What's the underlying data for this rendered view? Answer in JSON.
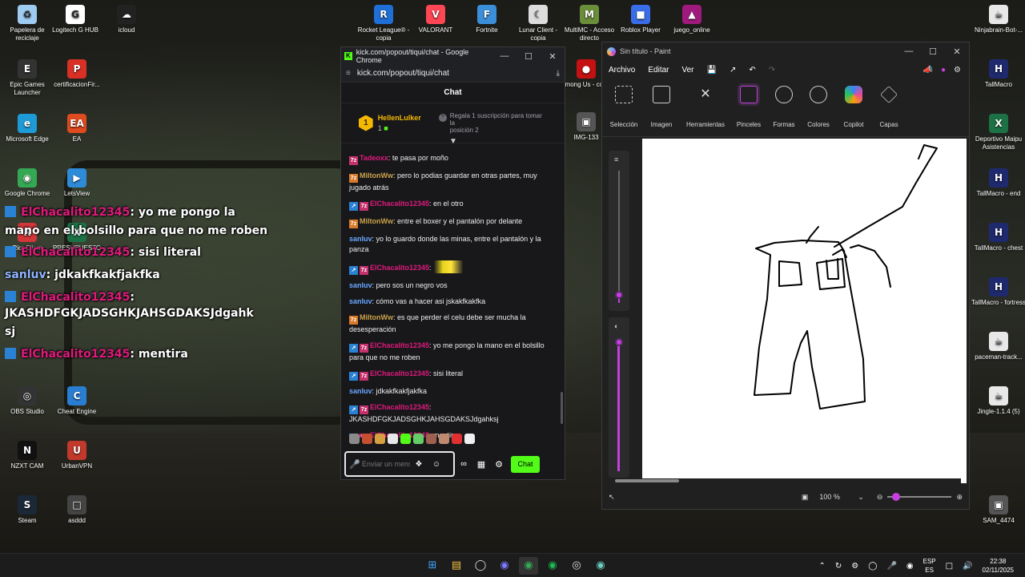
{
  "desktop": {
    "icons_left": [
      {
        "label": "Papelera de reciclaje",
        "icon": "recycle-bin-icon"
      },
      {
        "label": "Logitech G HUB",
        "icon": "logitech-icon"
      },
      {
        "label": "icloud",
        "icon": "icloud-icon"
      },
      {
        "label": "Epic Games Launcher",
        "icon": "epic-icon"
      },
      {
        "label": "certificacionFir...",
        "icon": "pdf-icon"
      },
      {
        "label": "Microsoft Edge",
        "icon": "edge-icon"
      },
      {
        "label": "EA",
        "icon": "ea-icon"
      },
      {
        "label": "Google Chrome",
        "icon": "chrome-icon"
      },
      {
        "label": "LetsView",
        "icon": "letsview-icon"
      },
      {
        "label": "Riot Client",
        "icon": "riot-icon"
      },
      {
        "label": "PRESUPUESTO",
        "icon": "excel-icon"
      },
      {
        "label": "OBS Studio",
        "icon": "obs-icon"
      },
      {
        "label": "Cheat Engine",
        "icon": "cheat-engine-icon"
      },
      {
        "label": "NZXT CAM",
        "icon": "nzxt-icon"
      },
      {
        "label": "UrbanVPN",
        "icon": "urbanvpn-icon"
      },
      {
        "label": "Steam",
        "icon": "steam-icon"
      },
      {
        "label": "asddd",
        "icon": "file-icon"
      }
    ],
    "icons_top": [
      {
        "label": "Rocket League® - copia",
        "icon": "rocket-league-icon"
      },
      {
        "label": "VALORANT",
        "icon": "valorant-icon"
      },
      {
        "label": "Fortnite",
        "icon": "fortnite-icon"
      },
      {
        "label": "Lunar Client - copia",
        "icon": "lunar-icon"
      },
      {
        "label": "MultiMC - Acceso directo",
        "icon": "multimc-icon"
      },
      {
        "label": "Roblox Player",
        "icon": "roblox-icon"
      },
      {
        "label": "juego_online",
        "icon": "game-icon"
      },
      {
        "label": "Among Us - copia",
        "icon": "among-us-icon"
      },
      {
        "label": "IMG-133",
        "icon": "image-icon"
      }
    ],
    "icons_right": [
      {
        "label": "Ninjabrain-Bot-...",
        "icon": "java-icon"
      },
      {
        "label": "TallMacro",
        "icon": "tallmacro-icon"
      },
      {
        "label": "Deportivo Maipu Asistencias",
        "icon": "excel-icon"
      },
      {
        "label": "TallMacro - end",
        "icon": "tallmacro-icon"
      },
      {
        "label": "TallMacro - chest",
        "icon": "tallmacro-icon"
      },
      {
        "label": "TallMacro - fortress",
        "icon": "tallmacro-icon"
      },
      {
        "label": "paceman-track...",
        "icon": "java-icon"
      },
      {
        "label": "Jingle-1.1.4 (5)",
        "icon": "java-icon"
      },
      {
        "label": "SAM_4474",
        "icon": "image-icon"
      }
    ]
  },
  "overlay_chat": [
    {
      "user": "ElChacalito12345",
      "text": ": yo me pongo la"
    },
    {
      "user": "",
      "text": "mano en el bolsillo para que no me roben"
    },
    {
      "user": "ElChacalito12345",
      "text": ": sisi literal"
    },
    {
      "user": "sanluv",
      "text": ": jdkakfkakfjakfka"
    },
    {
      "user": "ElChacalito12345",
      "text": ":"
    },
    {
      "user": "",
      "text": "JKASHDFGKJADSGHKJAHSGDAKSJdgahk"
    },
    {
      "user": "",
      "text": "sj"
    },
    {
      "user": "ElChacalito12345",
      "text": ": mentira"
    }
  ],
  "chrome": {
    "title": "kick.com/popout/tiqui/chat - Google Chrome",
    "url": "kick.com/popout/tiqui/chat",
    "chat_title": "Chat",
    "pinned": {
      "user": "HellenLulker",
      "count": "1",
      "gift_line1": "Regala 1 suscripción para tomar la",
      "gift_line2": "posición 2"
    },
    "messages": [
      {
        "user": "Tadeoxx",
        "text": ": te pasa por moño",
        "color": "red",
        "badges": [
          "pink"
        ]
      },
      {
        "user": "MiltonWw",
        "text": ": pero lo podias guardar en otras partes, muy jugado atrás",
        "color": "olive",
        "badges": [
          "orange"
        ]
      },
      {
        "user": "ElChacalito12345",
        "text": ": en el otro",
        "color": "red",
        "badges": [
          "blue",
          "pink"
        ]
      },
      {
        "user": "MiltonWw",
        "text": ": entre el boxer y el pantalón por delante",
        "color": "olive",
        "badges": [
          "orange"
        ]
      },
      {
        "user": "sanluv",
        "text": ": yo lo guardo donde las minas, entre el pantalón y la panza",
        "color": "blue",
        "badges": []
      },
      {
        "user": "ElChacalito12345",
        "text": ":",
        "color": "red",
        "badges": [
          "blue",
          "pink"
        ],
        "emote": true
      },
      {
        "user": "sanluv",
        "text": ": pero sos un negro vos",
        "color": "blue",
        "badges": []
      },
      {
        "user": "sanluv",
        "text": ": cómo vas a hacer asi jskakfkakfka",
        "color": "blue",
        "badges": []
      },
      {
        "user": "MiltonWw",
        "text": ": es que perder el celu debe ser mucha la desesperación",
        "color": "olive",
        "badges": [
          "orange"
        ]
      },
      {
        "user": "ElChacalito12345",
        "text": ": yo me pongo la mano en el bolsillo para que no me roben",
        "color": "red",
        "badges": [
          "blue",
          "pink"
        ]
      },
      {
        "user": "ElChacalito12345",
        "text": ": sisi literal",
        "color": "red",
        "badges": [
          "blue",
          "pink"
        ]
      },
      {
        "user": "sanluv",
        "text": ": jdkakfkakfjakfka",
        "color": "blue",
        "badges": []
      },
      {
        "user": "ElChacalito12345",
        "text": ": JKASHDFGKJADSGHKJAHSGDAKSJdgahksj",
        "color": "red",
        "badges": [
          "blue",
          "pink"
        ]
      },
      {
        "user": "ElChacalito12345",
        "text": ": mentira",
        "color": "red",
        "badges": [
          "blue",
          "pink"
        ]
      }
    ],
    "input_placeholder": "Enviar un mensaje",
    "send_label": "Chat"
  },
  "paint": {
    "title": "Sin título - Paint",
    "menu": [
      "Archivo",
      "Editar",
      "Ver"
    ],
    "ribbon": [
      "Selección",
      "Imagen",
      "Herramientas",
      "Pinceles",
      "Formas",
      "Colores",
      "Copilot",
      "Capas"
    ],
    "zoom": "100 %",
    "accent": "#c63fe0"
  },
  "taskbar": {
    "lang_line1": "ESP",
    "lang_line2": "ES",
    "time": "22:38",
    "date": "02/11/2025"
  }
}
